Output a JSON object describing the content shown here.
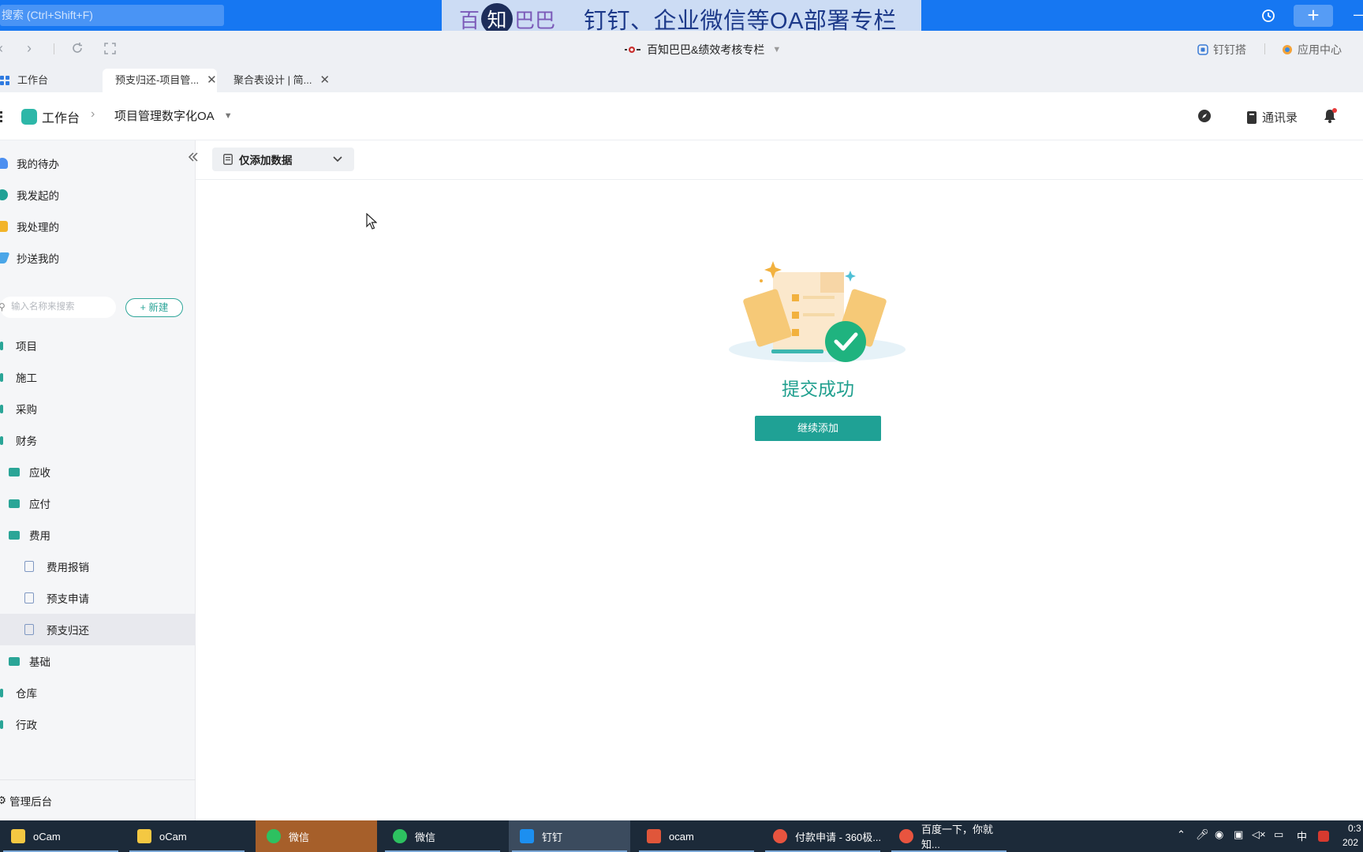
{
  "topbar": {
    "search_placeholder": "搜索 (Ctrl+Shift+F)",
    "plus": "+",
    "minus": "—"
  },
  "banner": {
    "brand_left": "百",
    "brand_mid": "知",
    "brand_right": "巴巴",
    "title": "钉钉、企业微信等OA部署专栏"
  },
  "browser": {
    "site_title": "百知巴巴&绩效考核专栏",
    "right_links": [
      "钉钉搭",
      "应用中心"
    ]
  },
  "tabs": [
    {
      "label": "工作台"
    },
    {
      "label": "预支归还-项目管..."
    },
    {
      "label": "聚合表设计 | 简..."
    }
  ],
  "app_header": {
    "workbench": "工作台",
    "app_name": "项目管理数字化OA",
    "contacts": "通讯录"
  },
  "sidebar": {
    "quick": [
      "我的待办",
      "我发起的",
      "我处理的",
      "抄送我的"
    ],
    "search_placeholder": "输入名称来搜索",
    "new_button": "新建",
    "tree": [
      {
        "label": "项目"
      },
      {
        "label": "施工"
      },
      {
        "label": "采购"
      },
      {
        "label": "财务"
      },
      {
        "label": "应收"
      },
      {
        "label": "应付"
      },
      {
        "label": "费用"
      },
      {
        "label": "费用报销"
      },
      {
        "label": "预支申请"
      },
      {
        "label": "预支归还"
      },
      {
        "label": "基础"
      },
      {
        "label": "仓库"
      },
      {
        "label": "行政"
      }
    ],
    "admin": "管理后台"
  },
  "main": {
    "filter_label": "仅添加数据",
    "success_title": "提交成功",
    "continue_button": "继续添加"
  },
  "taskbar": {
    "tasks": [
      "oCam",
      "oCam",
      "微信",
      "微信",
      "钉钉",
      "ocam",
      "付款申请 - 360极...",
      "百度一下，你就知..."
    ],
    "tray_ime": "中",
    "tray_time": "0:3",
    "tray_date": "202"
  },
  "colors": {
    "accent_teal": "#1fa195",
    "topbar_blue": "#1677f2",
    "taskbar": "#1c2a39"
  }
}
